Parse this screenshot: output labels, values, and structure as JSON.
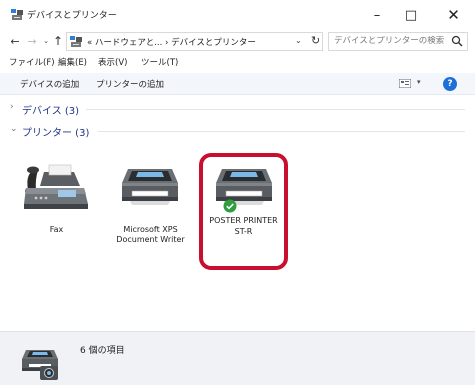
{
  "window": {
    "title": "デバイスとプリンター",
    "minimize": "–",
    "maximize": "□",
    "close": "✕"
  },
  "address": {
    "back": "←",
    "forward": "→",
    "recent": "⌄",
    "up": "↑",
    "path": "« ハードウェアと... › デバイスとプリンター",
    "dropdown": "⌄",
    "refresh": "↻",
    "search_placeholder": "デバイスとプリンターの検索"
  },
  "menu": [
    "ファイル(F)",
    "編集(E)",
    "表示(V)",
    "ツール(T)"
  ],
  "commands": {
    "add_device": "デバイスの追加",
    "add_printer": "プリンターの追加",
    "view_dropdown": "▾",
    "help": "?"
  },
  "groups": [
    {
      "chevron": "›",
      "label": "デバイス (3)",
      "expanded": false
    },
    {
      "chevron": "⌄",
      "label": "プリンター (3)",
      "expanded": true
    }
  ],
  "printers": [
    {
      "label_line1": "Fax",
      "label_line2": "",
      "icon": "fax-icon"
    },
    {
      "label_line1": "Microsoft XPS",
      "label_line2": "Document Writer",
      "icon": "printer-icon"
    },
    {
      "label_line1": "POSTER PRINTER",
      "label_line2": "ST-R",
      "icon": "printer-icon",
      "default": true,
      "highlighted": true
    }
  ],
  "details": {
    "item_count": "6 個の項目"
  },
  "colors": {
    "highlight": "#c8102e",
    "default_check": "#2e9e3e",
    "group_label": "#1e3287",
    "command_bar": "#f3f6fb"
  }
}
